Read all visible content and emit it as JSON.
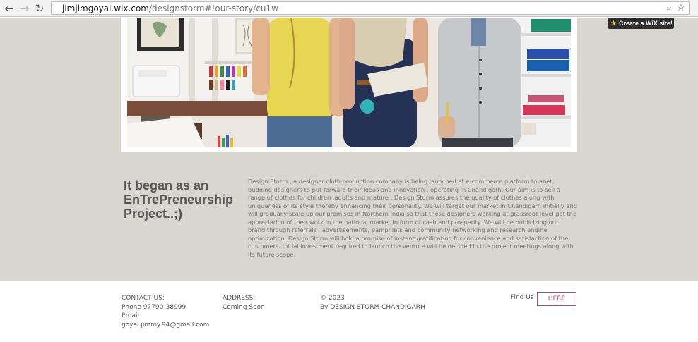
{
  "browser": {
    "url_host": "jimjimgoyal.wix.com",
    "url_path": "/designstorm#!our-story/cu1w",
    "back_icon": "arrow-left-icon",
    "forward_icon": "arrow-right-icon",
    "reload_icon": "reload-icon",
    "zoom_icon": "magnifier-icon",
    "bookmark_icon": "star-outline-icon"
  },
  "wix_badge": {
    "label": "Create a WiX site!",
    "icon": "star-icon"
  },
  "story": {
    "title": "It began as an EnTrePreneurship Project..;)",
    "body": "Design Storm , a designer cloth production company is being launched at e-commerce platform to abet budding designers to put forward their ideas and innovation , operating in Chandigarh. Our aim is to sell a range of clothes for children ,adults and mature . Design Storm assures the quality of clothes along with uniqueness of its style thereby enhancing their personality. We will target our market in Chandigarh initially and will gradually scale up our premises in Northern India so that these designers working at grassroot level get the appreciation of their work in the national market in form of cash and prosperity. We will be publicizing our brand through referrals , advertisements, pamphlets and community networking and research engine optimization. Design Storm will hold a promise of instant gratification for convenience and satisfaction of the customers. Initial investment required to launch the venture will be decided in the project meetings along with its future scope."
  },
  "footer": {
    "contact_heading": "CONTACT US:",
    "phone": "Phone 97790-38999",
    "email_label": "Email",
    "email": "goyal.jimmy.94@gmail.com",
    "address_heading": "ADDRESS:",
    "address": "Coming Soon",
    "copyright": "© 2023",
    "byline": "By DESIGN STORM CHANDIGARH",
    "find_us": "Find Us",
    "here_button": "HERE"
  },
  "colors": {
    "page_background": "#d8d6cf",
    "accent": "#b24b78"
  }
}
